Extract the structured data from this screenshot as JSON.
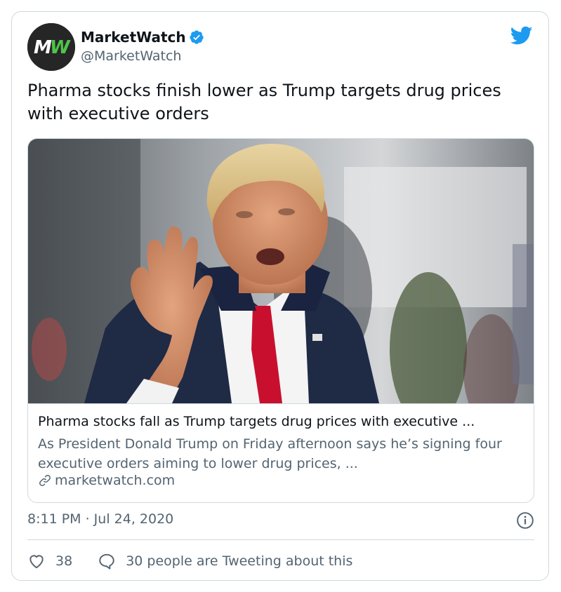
{
  "author": {
    "name": "MarketWatch",
    "handle": "@MarketWatch",
    "avatar_text": "MW",
    "avatar_colors": {
      "bg": "#262626",
      "green": "#4fc34a",
      "white": "#ffffff"
    },
    "verified": true
  },
  "tweet": {
    "text": "Pharma stocks finish lower as Trump targets drug prices with executive orders",
    "timestamp": "8:11 PM · Jul 24, 2020"
  },
  "card": {
    "title": "Pharma stocks fall as Trump targets drug prices with executive ...",
    "description": "As President Donald Trump on Friday afternoon says he’s signing four executive orders aiming to lower drug prices, ...",
    "domain": "marketwatch.com"
  },
  "engagement": {
    "likes": "38",
    "conversation_text": "30 people are Tweeting about this"
  },
  "icons": {
    "brand": "twitter-bird-icon",
    "verified": "verified-badge-icon",
    "info": "info-icon",
    "like": "heart-icon",
    "reply": "speech-bubble-icon",
    "link": "link-icon"
  },
  "colors": {
    "twitter_blue": "#1d9bf0",
    "text_primary": "#0f1419",
    "text_secondary": "#536471",
    "border": "#cfd9de"
  }
}
